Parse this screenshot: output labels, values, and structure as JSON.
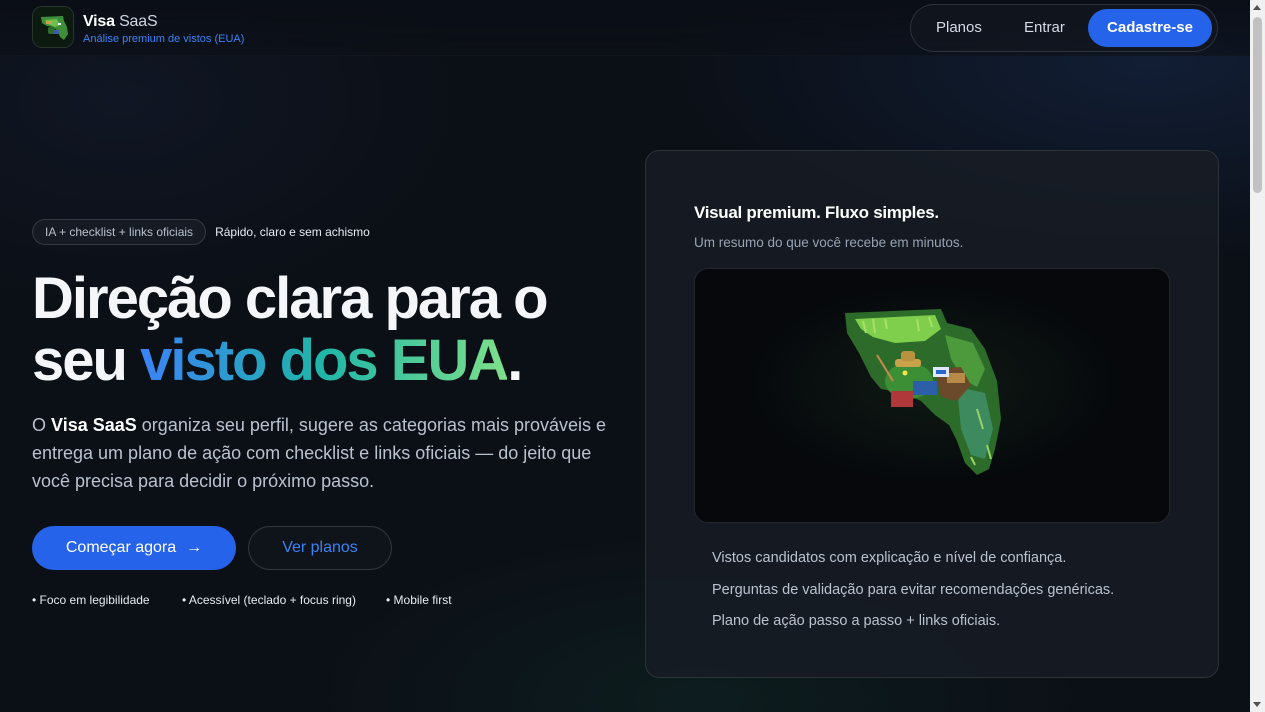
{
  "header": {
    "brand_name": "Visa",
    "brand_suffix": "SaaS",
    "brand_subtitle": "Análise premium de vistos (EUA)",
    "logo_icon": "florida-gator-logo-icon",
    "nav": {
      "plans": "Planos",
      "login": "Entrar",
      "signup": "Cadastre-se"
    }
  },
  "hero": {
    "badge": "IA + checklist + links oficiais",
    "badge_caption": "Rápido, claro e sem achismo",
    "headline_line1": "Direção clara para o",
    "headline_word": "seu",
    "headline_highlight": "visto dos EUA",
    "headline_period": ".",
    "lead_prefix": "O",
    "lead_brand": "Visa SaaS",
    "lead_text": "organiza seu perfil, sugere as categorias mais prováveis e entrega um plano de ação com checklist e links oficiais — do jeito que você precisa para decidir o próximo passo.",
    "cta_primary": "Começar agora",
    "cta_arrow": "→",
    "cta_secondary": "Ver planos",
    "features": [
      "• Foco em legibilidade",
      "• Acessível (teclado + focus ring)",
      "• Mobile first"
    ]
  },
  "card": {
    "title": "Visual premium. Fluxo simples.",
    "subtitle": "Um resumo do que você recebe em minutos.",
    "image_icon": "florida-gator-illustration-icon",
    "items": [
      "Vistos candidatos com explicação e nível de confiança.",
      "Perguntas de validação para evitar recomendações genéricas.",
      "Plano de ação passo a passo + links oficiais."
    ]
  },
  "colors": {
    "background": "#0b0f16",
    "accent": "#2563eb",
    "gradient_start": "#3b82f6",
    "gradient_mid": "#1fb6a8",
    "gradient_end": "#7ee08a"
  }
}
